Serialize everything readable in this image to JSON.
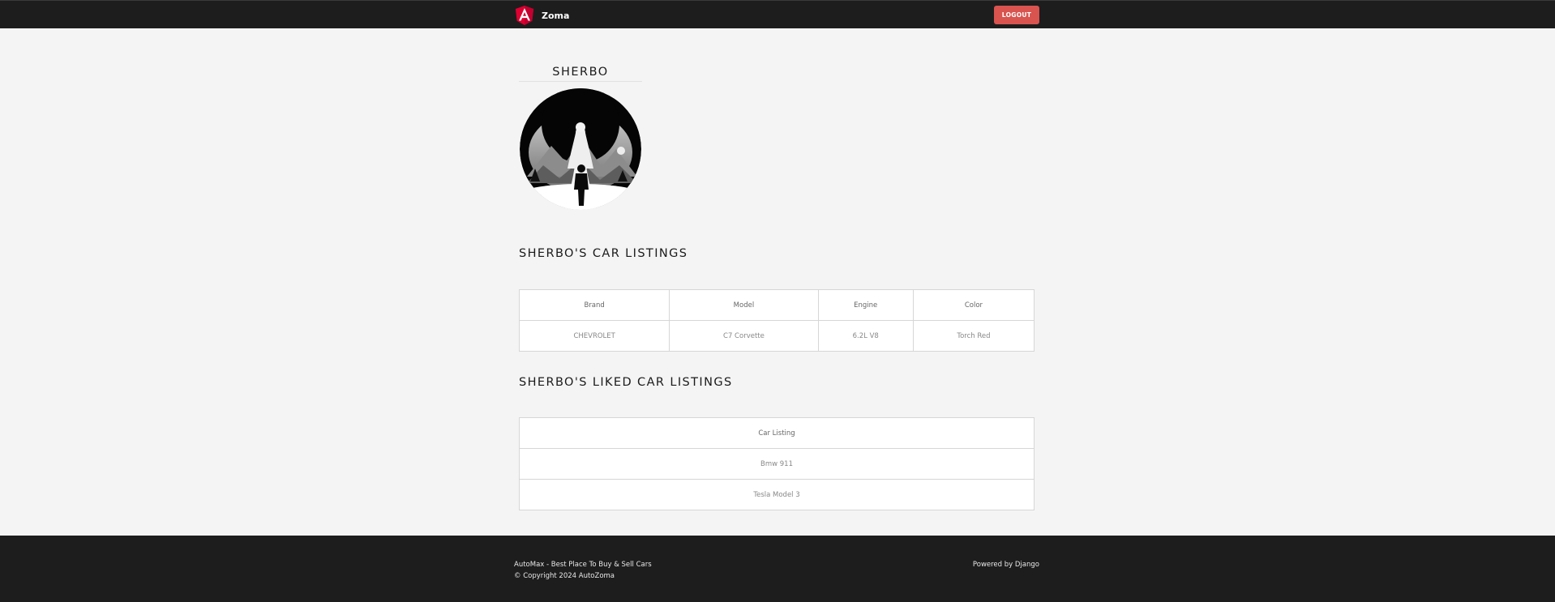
{
  "navbar": {
    "brand_name": "Zoma",
    "brand_icon": "angular-logo-icon",
    "logout_label": "LOGOUT",
    "logout_color": "#d9534f",
    "background": "#1d1d1d"
  },
  "profile": {
    "username": "SHERBO",
    "avatar_icon": "profile-avatar"
  },
  "listings": {
    "title": "SHERBO'S CAR LISTINGS",
    "columns": [
      "Brand",
      "Model",
      "Engine",
      "Color"
    ],
    "rows": [
      [
        "CHEVROLET",
        "C7 Corvette",
        "6.2L V8",
        "Torch Red"
      ]
    ]
  },
  "liked": {
    "title": "SHERBO'S LIKED CAR LISTINGS",
    "column": "Car Listing",
    "rows": [
      "Bmw 911",
      "Tesla Model 3"
    ]
  },
  "footer": {
    "tagline": "AutoMax - Best Place To Buy & Sell Cars",
    "copyright": "© Copyright 2024 AutoZoma",
    "powered_prefix": "Powered by",
    "powered_link": "Django"
  }
}
